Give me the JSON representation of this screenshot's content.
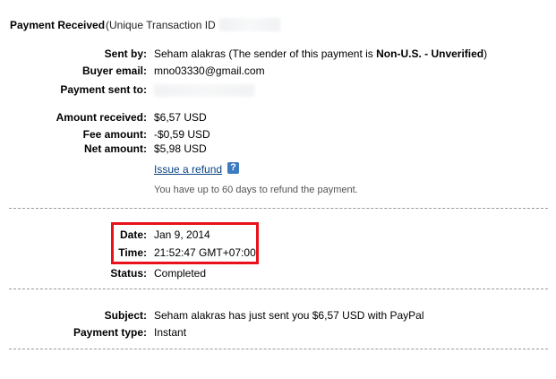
{
  "header": {
    "title": "Payment Received",
    "subtitle_prefix": "(Unique Transaction ID"
  },
  "details": {
    "sent_by_label": "Sent by:",
    "sent_by_value_prefix": "Seham alakras (The sender of this payment is ",
    "sent_by_value_bold": "Non-U.S. - Unverified",
    "sent_by_value_suffix": ")",
    "buyer_email_label": "Buyer email:",
    "buyer_email_value": "mno03330@gmail.com",
    "payment_sent_to_label": "Payment sent to:"
  },
  "amounts": {
    "received_label": "Amount received:",
    "received_value": "$6,57 USD",
    "fee_label": "Fee amount:",
    "fee_value": "-$0,59 USD",
    "net_label": "Net amount:",
    "net_value": "$5,98 USD",
    "refund_link": "Issue a refund",
    "help_glyph": "?",
    "help_icon": "help-icon",
    "refund_note": "You have up to 60 days to refund the payment."
  },
  "timing": {
    "date_label": "Date:",
    "date_value": "Jan 9, 2014",
    "time_label": "Time:",
    "time_value": "21:52:47 GMT+07:00",
    "status_label": "Status:",
    "status_value": "Completed",
    "highlight_color": "#e8121b"
  },
  "message": {
    "subject_label": "Subject:",
    "subject_value": "Seham alakras has just sent you $6,57 USD with PayPal",
    "payment_type_label": "Payment type:",
    "payment_type_value": "Instant"
  },
  "colors": {
    "link": "#084482",
    "help_icon_bg": "#3c7bbf",
    "divider": "#9a9a9a"
  }
}
